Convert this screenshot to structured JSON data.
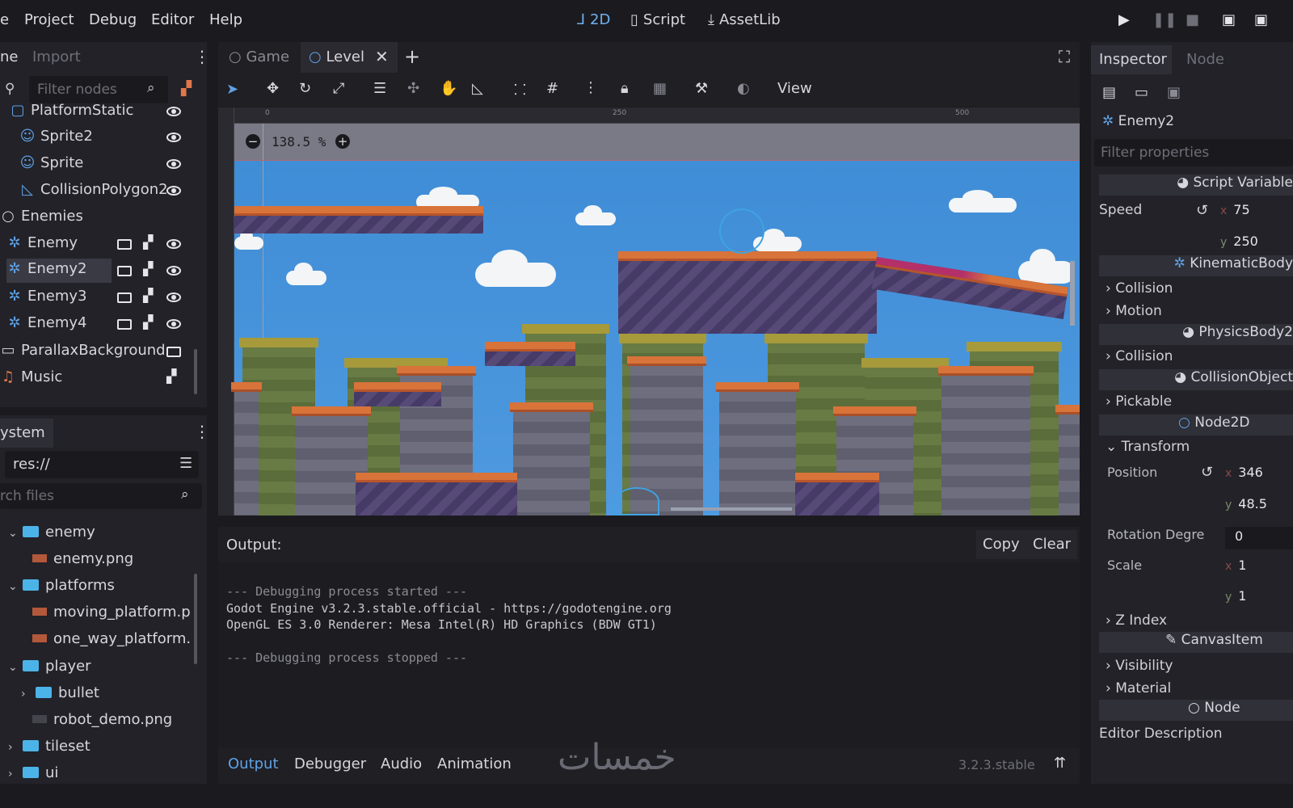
{
  "menu": [
    "e",
    "Project",
    "Debug",
    "Editor",
    "Help"
  ],
  "workspaces": [
    {
      "label": "2D",
      "icon": "2d-axis-icon",
      "active": true
    },
    {
      "label": "Script",
      "icon": "script-icon",
      "active": false
    },
    {
      "label": "AssetLib",
      "icon": "download-icon",
      "active": false
    }
  ],
  "scene_dock": {
    "tabs": [
      "ne",
      "Import"
    ],
    "filter_placeholder": "Filter nodes",
    "nodes": [
      {
        "label": "PlatformStatic"
      },
      {
        "label": "Sprite2"
      },
      {
        "label": "Sprite"
      },
      {
        "label": "CollisionPolygon2"
      },
      {
        "label": "Enemies"
      },
      {
        "label": "Enemy"
      },
      {
        "label": "Enemy2"
      },
      {
        "label": "Enemy3"
      },
      {
        "label": "Enemy4"
      },
      {
        "label": "ParallaxBackground"
      },
      {
        "label": "Music"
      }
    ]
  },
  "filesystem_dock": {
    "tab": "ystem",
    "path": "res://",
    "search_placeholder": "rch files",
    "items": [
      {
        "label": "enemy",
        "type": "folder"
      },
      {
        "label": "enemy.png",
        "type": "png"
      },
      {
        "label": "platforms",
        "type": "folder"
      },
      {
        "label": "moving_platform.p",
        "type": "png"
      },
      {
        "label": "one_way_platform.",
        "type": "png"
      },
      {
        "label": "player",
        "type": "folder"
      },
      {
        "label": "bullet",
        "type": "folder"
      },
      {
        "label": "robot_demo.png",
        "type": "png"
      },
      {
        "label": "tileset",
        "type": "folder"
      },
      {
        "label": "ui",
        "type": "folder"
      }
    ]
  },
  "editor_tabs": [
    {
      "label": "Game",
      "active": false
    },
    {
      "label": "Level",
      "active": true
    }
  ],
  "toolbar": {
    "view_label": "View"
  },
  "viewport": {
    "zoom": "138.5 %",
    "ruler_marks": [
      "0",
      "250",
      "500"
    ]
  },
  "inspector": {
    "tabs": [
      "Inspector",
      "Node"
    ],
    "node_name": "Enemy2",
    "filter_placeholder": "Filter properties",
    "sections": {
      "script_vars": "Script Variable",
      "kinematic": "KinematicBody",
      "physics": "PhysicsBody2",
      "collision_object": "CollisionObject",
      "node2d": "Node2D",
      "canvas_item": "CanvasItem",
      "node": "Node"
    },
    "props": {
      "speed_label": "Speed",
      "speed_x": "75",
      "speed_y": "250",
      "collision_1": "Collision",
      "motion": "Motion",
      "collision_2": "Collision",
      "pickable": "Pickable",
      "transform": "Transform",
      "position_label": "Position",
      "position_x": "346",
      "position_y": "48.5",
      "rotation_label": "Rotation Degre",
      "rotation_value": "0",
      "scale_label": "Scale",
      "scale_x": "1",
      "scale_y": "1",
      "z_index": "Z Index",
      "visibility": "Visibility",
      "material": "Material",
      "editor_description": "Editor Description"
    }
  },
  "output": {
    "title": "Output:",
    "copy_label": "Copy",
    "clear_label": "Clear",
    "lines": [
      "--- Debugging process started ---",
      "Godot Engine v3.2.3.stable.official - https://godotengine.org",
      "OpenGL ES 3.0 Renderer: Mesa Intel(R) HD Graphics (BDW GT1)",
      "",
      "--- Debugging process stopped ---"
    ]
  },
  "bottom_tabs": [
    "Output",
    "Debugger",
    "Audio",
    "Animation"
  ],
  "version": "3.2.3.stable",
  "watermark": "خمسات",
  "colors": {
    "accent": "#5fa2e6",
    "folder": "#4cb3e8",
    "background": "#1b1b1f",
    "panel": "#222228"
  }
}
